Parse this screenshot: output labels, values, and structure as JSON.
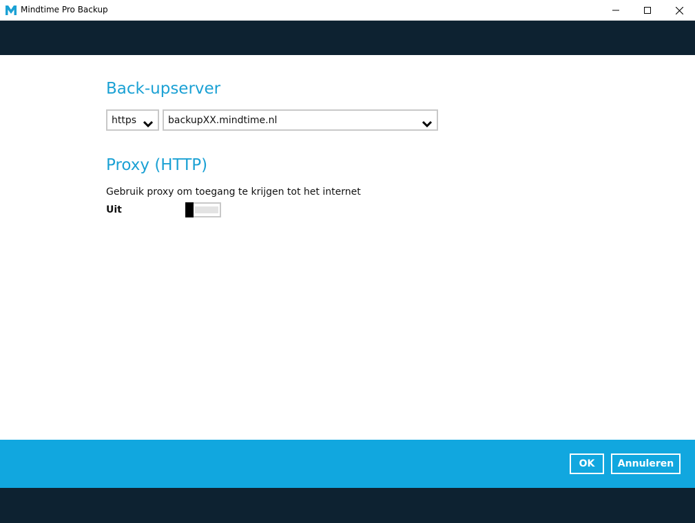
{
  "window": {
    "title": "Mindtime Pro Backup",
    "logo_icon": "mindtime-logo-icon",
    "controls": [
      "minimize-icon",
      "maximize-icon",
      "close-icon"
    ]
  },
  "server": {
    "section_title": "Back-upserver",
    "protocol": "https",
    "address": "backupXX.mindtime.nl"
  },
  "proxy": {
    "section_title": "Proxy (HTTP)",
    "description": "Gebruik proxy om toegang te krijgen tot het internet",
    "state_label": "Uit",
    "enabled": false
  },
  "footer": {
    "ok_label": "OK",
    "cancel_label": "Annuleren"
  },
  "colors": {
    "accent": "#1ba1d4",
    "footer": "#11a7df",
    "dark_band": "#0d2231"
  }
}
